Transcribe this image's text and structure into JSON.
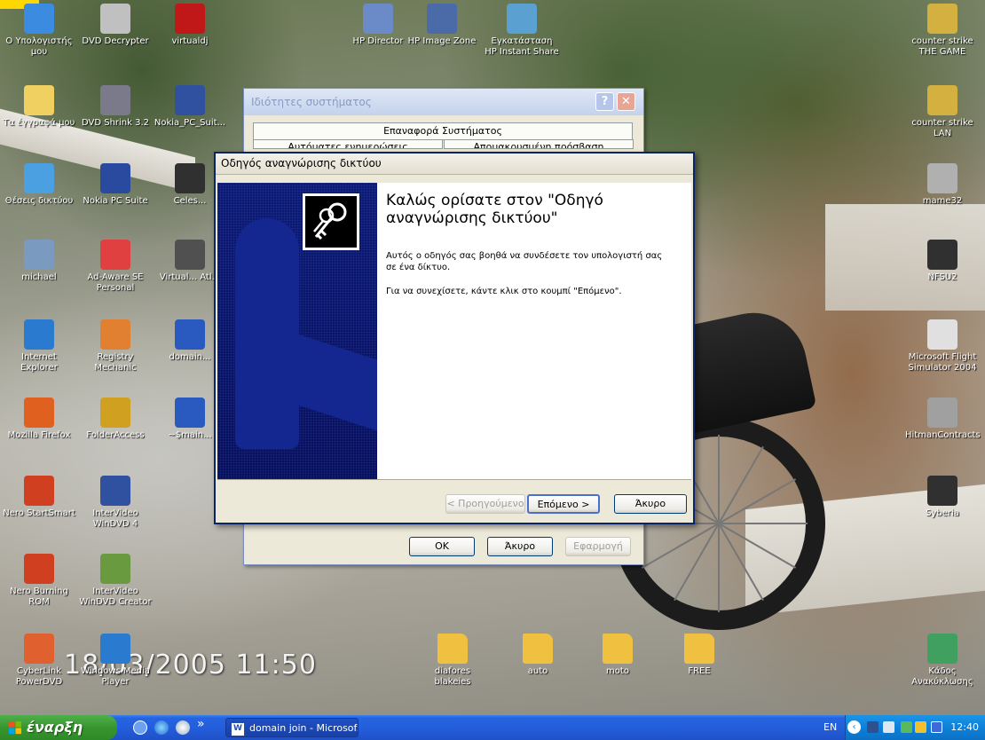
{
  "desktop": {
    "datestamp": "18/03/2005 11:50",
    "icons": [
      {
        "label": "Ο Υπολογιστής μου",
        "icon": "my-computer-icon"
      },
      {
        "label": "DVD Decrypter",
        "icon": "dvd-decrypter-icon"
      },
      {
        "label": "virtualdj",
        "icon": "virtualdj-icon"
      },
      {
        "label": "HP Director",
        "icon": "hp-director-icon"
      },
      {
        "label": "HP Image Zone",
        "icon": "hp-image-zone-icon"
      },
      {
        "label": "Εγκατάσταση HP Instant Share",
        "icon": "hp-instant-share-icon"
      },
      {
        "label": "counter strike THE GAME",
        "icon": "counter-strike-icon"
      },
      {
        "label": "Τα έγγραφά μου",
        "icon": "my-documents-icon"
      },
      {
        "label": "DVD Shrink 3.2",
        "icon": "dvd-shrink-icon"
      },
      {
        "label": "Nokia_PC_Suit...",
        "icon": "nokia-pc-suite-icon"
      },
      {
        "label": "counter strike LAN",
        "icon": "counter-strike-lan-icon"
      },
      {
        "label": "Θέσεις δικτύου",
        "icon": "network-places-icon"
      },
      {
        "label": "Nokia PC Suite",
        "icon": "nokia-icon"
      },
      {
        "label": "Celes...",
        "icon": "celestia-icon"
      },
      {
        "label": "mame32",
        "icon": "mame32-icon"
      },
      {
        "label": "michael",
        "icon": "michael-icon"
      },
      {
        "label": "Ad-Aware SE Personal",
        "icon": "ad-aware-icon"
      },
      {
        "label": "Virtual... Atl...",
        "icon": "virtual-atlas-icon"
      },
      {
        "label": "NFSU2",
        "icon": "nfsu2-icon"
      },
      {
        "label": "Internet Explorer",
        "icon": "internet-explorer-icon"
      },
      {
        "label": "Registry Mechanic",
        "icon": "registry-mechanic-icon"
      },
      {
        "label": "domain...",
        "icon": "word-document-icon"
      },
      {
        "label": "Microsoft Flight Simulator 2004",
        "icon": "flight-simulator-icon"
      },
      {
        "label": "Mozilla Firefox",
        "icon": "firefox-icon"
      },
      {
        "label": "FolderAccess",
        "icon": "folder-access-icon"
      },
      {
        "label": "~$main...",
        "icon": "word-temp-document-icon"
      },
      {
        "label": "HitmanContracts",
        "icon": "hitman-icon"
      },
      {
        "label": "Nero StartSmart",
        "icon": "nero-startsmart-icon"
      },
      {
        "label": "InterVideo WinDVD 4",
        "icon": "windvd-icon"
      },
      {
        "label": "Syberia",
        "icon": "syberia-icon"
      },
      {
        "label": "Nero Burning ROM",
        "icon": "nero-burning-rom-icon"
      },
      {
        "label": "InterVideo WinDVD Creator",
        "icon": "windvd-creator-icon"
      },
      {
        "label": "CyberLink PowerDVD",
        "icon": "powerdvd-icon"
      },
      {
        "label": "Windows Media Player",
        "icon": "media-player-icon"
      },
      {
        "label": "diafores blakeies",
        "icon": "folder-icon"
      },
      {
        "label": "auto",
        "icon": "folder-icon"
      },
      {
        "label": "moto",
        "icon": "folder-icon"
      },
      {
        "label": "FREE",
        "icon": "folder-icon"
      },
      {
        "label": "Κάδος Ανακύκλωσης",
        "icon": "recycle-bin-icon"
      }
    ]
  },
  "sysprops": {
    "title": "Ιδιότητες συστήματος",
    "tab_row1": "Επαναφορά Συστήματος",
    "tab_row2": [
      "Αυτόματες ενημερώσεις",
      "Απομακρυσμένη πρόσβαση"
    ],
    "ok_label": "OK",
    "cancel_label": "Άκυρο",
    "apply_label": "Εφαρμογή",
    "help_glyph": "?",
    "close_glyph": "✕"
  },
  "wizard": {
    "title": "Οδηγός αναγνώρισης δικτύου",
    "heading": "Καλώς ορίσατε στον \"Οδηγό αναγνώρισης δικτύου\"",
    "para1": "Αυτός ο οδηγός σας βοηθά να συνδέσετε τον υπολογιστή σας σε ένα δίκτυο.",
    "para2": "Για να συνεχίσετε, κάντε κλικ στο κουμπί \"Επόμενο\".",
    "back_label": "< Προηγούμενο",
    "next_label": "Επόμενο >",
    "cancel_label": "Άκυρο"
  },
  "taskbar": {
    "start_label": "έναρξη",
    "chevron": "»",
    "task_label": "domain join - Microsof...",
    "language": "EN",
    "clock": "12:40"
  },
  "colors": {
    "taskbar_blue": "#245edb",
    "start_green": "#37952f",
    "wizard_side": "#0b1a78",
    "tray_blue": "#0e80d8"
  }
}
